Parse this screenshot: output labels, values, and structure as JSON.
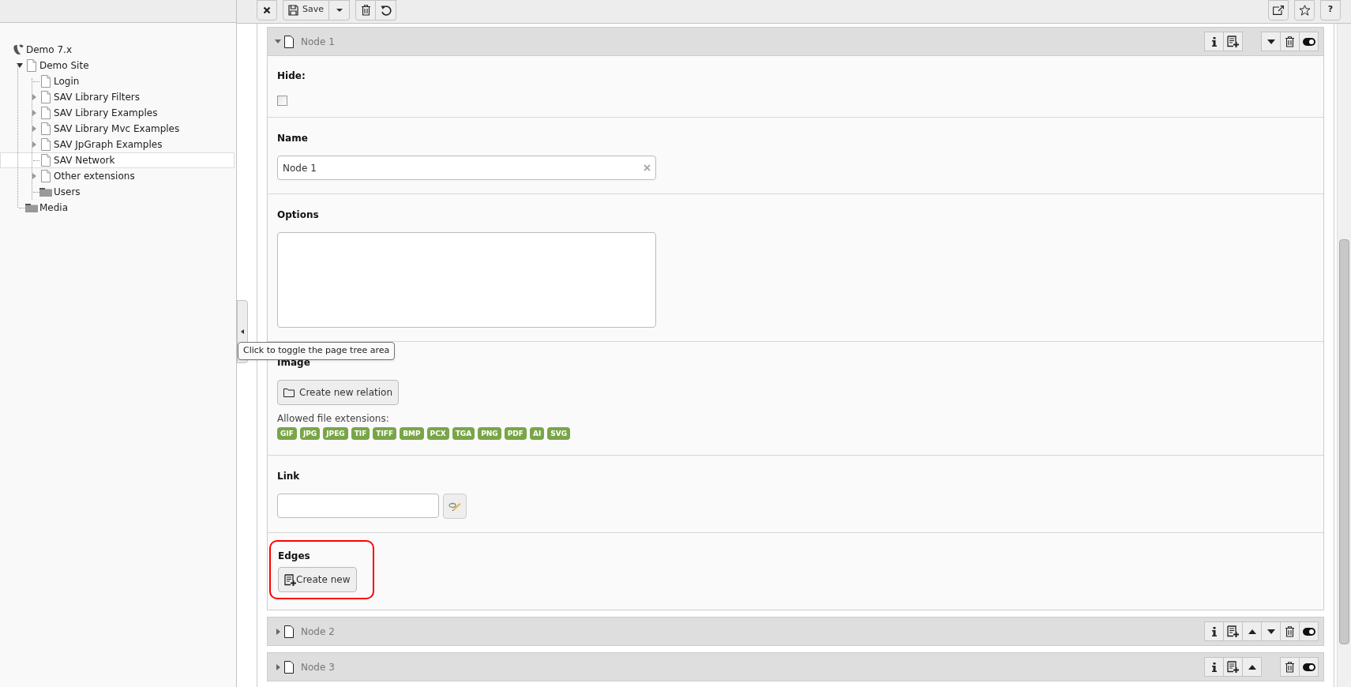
{
  "page_tree": {
    "root": {
      "label": "Demo 7.x",
      "children": [
        {
          "label": "Demo Site",
          "kind": "page",
          "has_children": true,
          "expanded": true,
          "selected": false,
          "children": [
            {
              "label": "Login",
              "kind": "page",
              "has_children": false,
              "selected": false
            },
            {
              "label": "SAV Library Filters",
              "kind": "page",
              "has_children": true,
              "expanded": false,
              "selected": false
            },
            {
              "label": "SAV Library Examples",
              "kind": "page",
              "has_children": true,
              "expanded": false,
              "selected": false
            },
            {
              "label": "SAV Library Mvc Examples",
              "kind": "page",
              "has_children": true,
              "expanded": false,
              "selected": false
            },
            {
              "label": "SAV JpGraph Examples",
              "kind": "page",
              "has_children": true,
              "expanded": false,
              "selected": false
            },
            {
              "label": "SAV Network",
              "kind": "page",
              "has_children": false,
              "selected": true
            },
            {
              "label": "Other extensions",
              "kind": "page",
              "has_children": true,
              "expanded": false,
              "selected": false
            },
            {
              "label": "Users",
              "kind": "folder",
              "has_children": false,
              "selected": false
            }
          ]
        },
        {
          "label": "Media",
          "kind": "folder",
          "has_children": false,
          "selected": false
        }
      ]
    }
  },
  "tooltip": "Click to toggle the page tree area",
  "toolbar": {
    "save_label": "Save",
    "help_label": "?"
  },
  "nodes": [
    {
      "title": "Node 1",
      "expanded": true,
      "move_up": false,
      "move_down": true,
      "fields": [
        {
          "kind": "checkbox",
          "label": "Hide:",
          "checked": false
        },
        {
          "kind": "text",
          "label": "Name",
          "value": "Node 1"
        },
        {
          "kind": "textarea",
          "label": "Options"
        },
        {
          "kind": "file",
          "label": "Image",
          "button": "Create new relation",
          "hint": "Allowed file extensions:",
          "extensions": [
            "GIF",
            "JPG",
            "JPEG",
            "TIF",
            "TIFF",
            "BMP",
            "PCX",
            "TGA",
            "PNG",
            "PDF",
            "AI",
            "SVG"
          ]
        },
        {
          "kind": "link",
          "label": "Link"
        },
        {
          "kind": "inline",
          "label": "Edges",
          "button": "Create new",
          "highlighted": true
        }
      ]
    },
    {
      "title": "Node 2",
      "expanded": false,
      "move_up": true,
      "move_down": true
    },
    {
      "title": "Node 3",
      "expanded": false,
      "move_up": true,
      "move_down": false
    }
  ]
}
